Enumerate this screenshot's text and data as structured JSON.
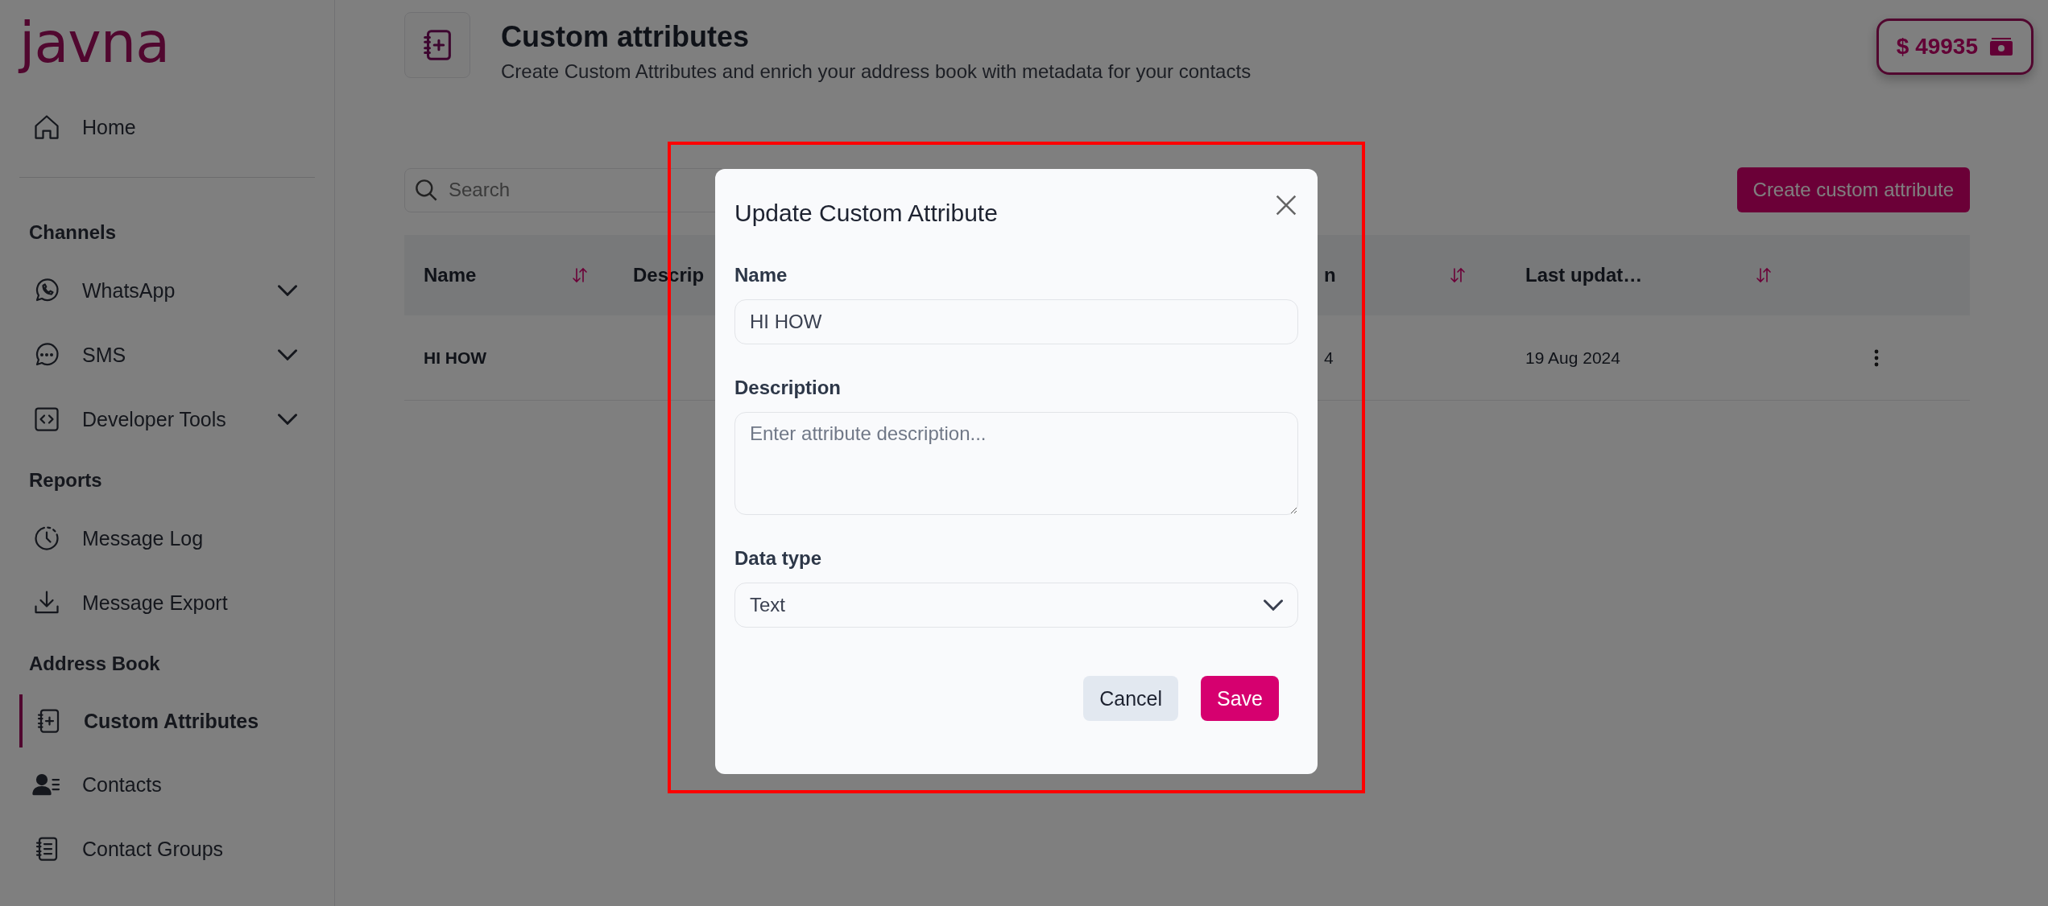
{
  "sidebar": {
    "logo": "javna",
    "sections": [
      {
        "items": [
          {
            "label": "Home",
            "kind": "link",
            "selected": false
          }
        ]
      },
      {
        "title": "Channels",
        "items": [
          {
            "label": "WhatsApp",
            "kind": "group",
            "expanded": false,
            "selected": false
          },
          {
            "label": "SMS",
            "kind": "group",
            "expanded": false,
            "selected": false
          },
          {
            "label": "Developer Tools",
            "kind": "group",
            "expanded": false,
            "selected": false
          }
        ]
      },
      {
        "title": "Reports",
        "items": [
          {
            "label": "Message Log",
            "kind": "link",
            "selected": false
          },
          {
            "label": "Message Export",
            "kind": "link",
            "selected": false
          }
        ]
      },
      {
        "title": "Address Book",
        "items": [
          {
            "label": "Custom Attributes",
            "kind": "link",
            "selected": true
          },
          {
            "label": "Contacts",
            "kind": "link",
            "selected": false
          },
          {
            "label": "Contact Groups",
            "kind": "link",
            "selected": false
          }
        ]
      }
    ]
  },
  "header": {
    "title": "Custom attributes",
    "subtitle": "Create Custom Attributes and enrich your address book with metadata for your contacts",
    "balance": "$ 49935"
  },
  "toolbar": {
    "search": {
      "placeholder": "Search"
    },
    "create_button": "Create custom attribute"
  },
  "table": {
    "columns": [
      {
        "label": "Name",
        "sortable": true
      },
      {
        "label": "Descrip"
      },
      {
        "label": "n",
        "sortable": true
      },
      {
        "label": "Last updat…",
        "sortable": true
      }
    ],
    "rows": [
      {
        "cells": [
          "HI HOW",
          "",
          "4",
          "19 Aug 2024"
        ]
      }
    ]
  },
  "modal": {
    "title": "Update Custom Attribute",
    "fields": [
      {
        "label": "Name",
        "kind": "input",
        "value": "HI HOW"
      },
      {
        "label": "Description",
        "kind": "textarea",
        "placeholder": "Enter attribute description..."
      },
      {
        "label": "Data type",
        "kind": "select",
        "value": "Text"
      }
    ],
    "buttons": [
      {
        "label": "Cancel",
        "kind": "secondary"
      },
      {
        "label": "Save",
        "kind": "primary"
      }
    ]
  },
  "annotation": {
    "highlight": true
  }
}
